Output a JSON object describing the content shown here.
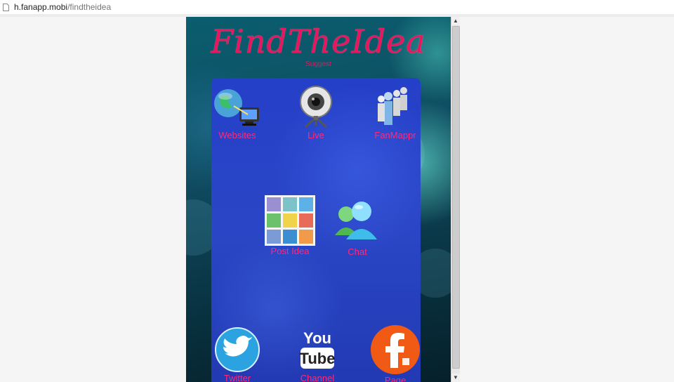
{
  "address_bar": {
    "host": "h.fanapp.mobi",
    "path": "/findtheidea"
  },
  "app": {
    "logo": "FindTheIdea",
    "suggest_link": "Suggest",
    "tiles": [
      {
        "label": "Websites",
        "icon": "globe-monitor-icon"
      },
      {
        "label": "Live",
        "icon": "webcam-icon"
      },
      {
        "label": "FanMappr",
        "icon": "people-group-icon"
      },
      {
        "label": "Post Idea",
        "icon": "post-idea-grid-icon"
      },
      {
        "label": "Chat",
        "icon": "chat-users-icon"
      },
      {
        "label": "Twitter",
        "icon": "twitter-bird-icon"
      },
      {
        "label": "Channel",
        "icon": "youtube-icon"
      },
      {
        "label": "Page",
        "icon": "facebook-icon"
      }
    ],
    "colors": {
      "label": "#ff2a7a",
      "logo": "#e8175d",
      "panel": "#2a46c6"
    }
  }
}
